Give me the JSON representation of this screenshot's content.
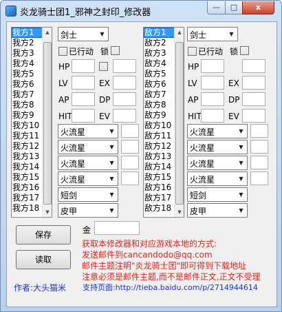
{
  "window": {
    "title": "炎龙骑士团1_邪神之封印_修改器",
    "min_glyph": "—",
    "max_glyph": "□",
    "close_glyph": "x"
  },
  "left_panel": {
    "list": [
      "我方1",
      "我方2",
      "我方3",
      "我方4",
      "我方5",
      "我方6",
      "我方7",
      "我方8",
      "我方9",
      "我方10",
      "我方11",
      "我方12",
      "我方13",
      "我方14",
      "我方15",
      "我方16",
      "我方17",
      "我方18"
    ],
    "class_value": "剑士",
    "acted_label": "已行动",
    "lock_label": "锁",
    "stats": {
      "hp": "HP",
      "lv": "LV",
      "ex": "EX",
      "ap": "AP",
      "dp": "DP",
      "hit": "HIT",
      "ev": "EV"
    },
    "magic": [
      "火流星",
      "火流星",
      "火流星",
      "火流星"
    ],
    "weapon": "短剑",
    "armor": "皮甲"
  },
  "right_panel": {
    "list": [
      "敌方1",
      "敌方2",
      "敌方3",
      "敌方4",
      "敌方5",
      "敌方6",
      "敌方7",
      "敌方8",
      "敌方9",
      "敌方10",
      "敌方11",
      "敌方12",
      "敌方13",
      "敌方14",
      "敌方15",
      "敌方16",
      "敌方17",
      "敌方18"
    ],
    "class_value": "剑士",
    "acted_label": "已行动",
    "lock_label": "锁",
    "stats": {
      "hp": "HP",
      "lv": "LV",
      "ex": "EX",
      "ap": "AP",
      "dp": "DP",
      "hit": "HIT",
      "ev": "EV"
    },
    "magic": [
      "火流星",
      "火流星",
      "火流星",
      "火流星"
    ],
    "weapon": "短剑",
    "armor": "皮甲"
  },
  "footer": {
    "save_label": "保存",
    "load_label": "读取",
    "gold_label": "金",
    "gold_value": "",
    "info_lines": [
      "获取本修改器和对应游戏本地的方式:",
      "发送邮件到cancandodo@qq.com",
      "邮件主题注明\"炎龙骑士团\"即可得到下载地址",
      "注意必须是邮件主题,而不是邮件正文,正文不受理"
    ],
    "author": "作者:大头猫米",
    "support": "支持页面:http://tieba.baidu.com/p/2714944614"
  },
  "icons": {
    "dropdown": "chevron-down-icon",
    "scroll_up": "arrow-up-icon",
    "scroll_down": "arrow-down-icon"
  },
  "colors": {
    "selection": "#3399ff",
    "info_text": "#e0251e",
    "author_text": "#1c2fd6"
  }
}
